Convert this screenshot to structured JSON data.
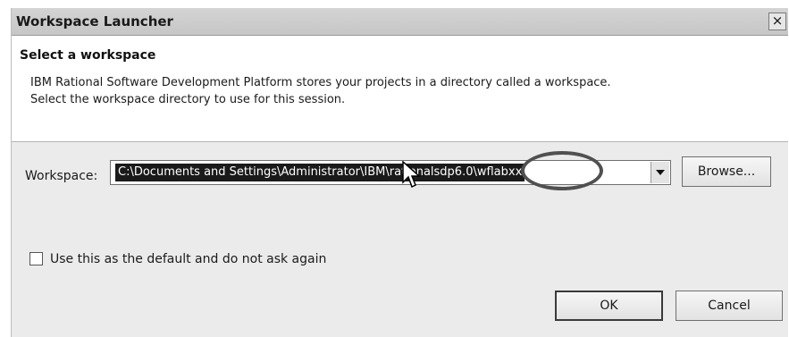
{
  "window": {
    "title": "Workspace Launcher",
    "close_symbol": "×"
  },
  "header": {
    "title": "Select a workspace",
    "description_line1": "IBM Rational Software Development Platform stores your projects in a directory called a workspace.",
    "description_line2": "Select the workspace directory to use for this session."
  },
  "workspace": {
    "label": "Workspace:",
    "value": "C:\\Documents and Settings\\Administrator\\IBM\\rationalsdp6.0\\wflabxx",
    "value_selected": true
  },
  "buttons": {
    "browse": "Browse...",
    "ok": "OK",
    "cancel": "Cancel"
  },
  "default_checkbox": {
    "label": "Use this as the default and do not ask again",
    "checked": false
  },
  "icons": {
    "close": "close-icon",
    "dropdown": "chevron-down-icon",
    "cursor": "mouse-pointer-icon"
  }
}
